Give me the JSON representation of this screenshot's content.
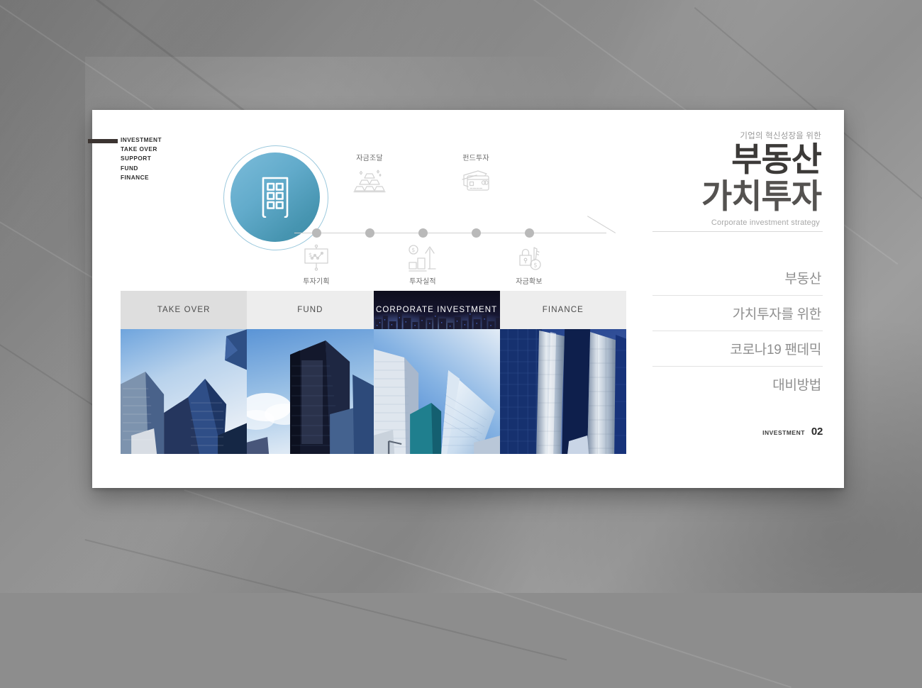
{
  "slide": {
    "nav_items": [
      "INVESTMENT",
      "TAKE OVER",
      "SUPPORT",
      "FUND",
      "FINANCE"
    ],
    "hero_icon": "building-icon",
    "timeline": {
      "nodes": [
        {
          "label": "투자기획",
          "icon": "presentation-chart-icon",
          "position": "below"
        },
        {
          "label": "자금조달",
          "icon": "gold-bars-icon",
          "position": "above"
        },
        {
          "label": "투자실적",
          "icon": "bar-growth-icon",
          "position": "below"
        },
        {
          "label": "펀드투자",
          "icon": "credit-cards-icon",
          "position": "above"
        },
        {
          "label": "자금확보",
          "icon": "lock-money-icon",
          "position": "below"
        }
      ]
    },
    "tabs": [
      {
        "label": "TAKE OVER",
        "active": false
      },
      {
        "label": "FUND",
        "active": false
      },
      {
        "label": "CORPORATE INVESTMENT",
        "active": true
      },
      {
        "label": "FINANCE",
        "active": false
      }
    ],
    "photos": [
      "glass-towers-blue-sky-photo",
      "dark-tower-clouds-photo",
      "curved-skyscraper-photo",
      "twin-glass-towers-photo"
    ],
    "heading": {
      "kicker": "기업의 혁신성장을 위한",
      "line1": "부동산",
      "line2": "가치투자",
      "subtitle": "Corporate investment strategy"
    },
    "points": [
      "부동산",
      "가치투자를 위한",
      "코로나19 팬데믹",
      "대비방법"
    ],
    "page_marker": {
      "label": "INVESTMENT",
      "number": "02"
    },
    "colors": {
      "accent_light": "#7cbcda",
      "accent_dark": "#3d8ba6",
      "ring": "#9cc9dd",
      "heading_dark": "#3c3a38",
      "heading_gray": "#545250",
      "muted": "#9a9a9a",
      "tab_inactive_a": "#dedede",
      "tab_inactive_b": "#ededed",
      "tab_active_bg": "#11112a"
    }
  }
}
